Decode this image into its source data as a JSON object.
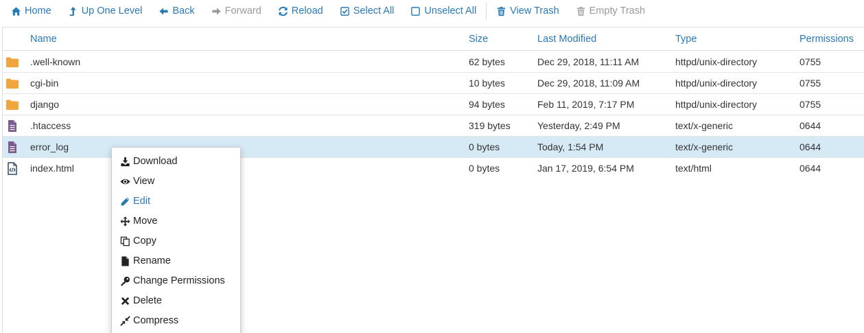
{
  "toolbar": {
    "home": "Home",
    "up_one_level": "Up One Level",
    "back": "Back",
    "forward": "Forward",
    "reload": "Reload",
    "select_all": "Select All",
    "unselect_all": "Unselect All",
    "view_trash": "View Trash",
    "empty_trash": "Empty Trash"
  },
  "table": {
    "headers": {
      "name": "Name",
      "size": "Size",
      "last_modified": "Last Modified",
      "type": "Type",
      "permissions": "Permissions"
    },
    "rows": [
      {
        "name": ".well-known",
        "size": "62 bytes",
        "modified": "Dec 29, 2018, 11:11 AM",
        "type": "httpd/unix-directory",
        "perms": "0755",
        "icon": "folder-icon"
      },
      {
        "name": "cgi-bin",
        "size": "10 bytes",
        "modified": "Dec 29, 2018, 11:09 AM",
        "type": "httpd/unix-directory",
        "perms": "0755",
        "icon": "folder-icon"
      },
      {
        "name": "django",
        "size": "94 bytes",
        "modified": "Feb 11, 2019, 7:17 PM",
        "type": "httpd/unix-directory",
        "perms": "0755",
        "icon": "folder-icon"
      },
      {
        "name": ".htaccess",
        "size": "319 bytes",
        "modified": "Yesterday, 2:49 PM",
        "type": "text/x-generic",
        "perms": "0644",
        "icon": "text-file-icon"
      },
      {
        "name": "error_log",
        "size": "0 bytes",
        "modified": "Today, 1:54 PM",
        "type": "text/x-generic",
        "perms": "0644",
        "icon": "text-file-icon"
      },
      {
        "name": "index.html",
        "size": "0 bytes",
        "modified": "Jan 17, 2019, 6:54 PM",
        "type": "text/html",
        "perms": "0644",
        "icon": "code-file-icon"
      }
    ]
  },
  "context_menu": {
    "items": [
      "Download",
      "View",
      "Edit",
      "Move",
      "Copy",
      "Rename",
      "Change Permissions",
      "Delete",
      "Compress"
    ]
  },
  "colors": {
    "accent": "#2a79b7",
    "folder": "#f0a63c",
    "file": "#7b5a8e",
    "selected_row": "#d6eaf6"
  }
}
